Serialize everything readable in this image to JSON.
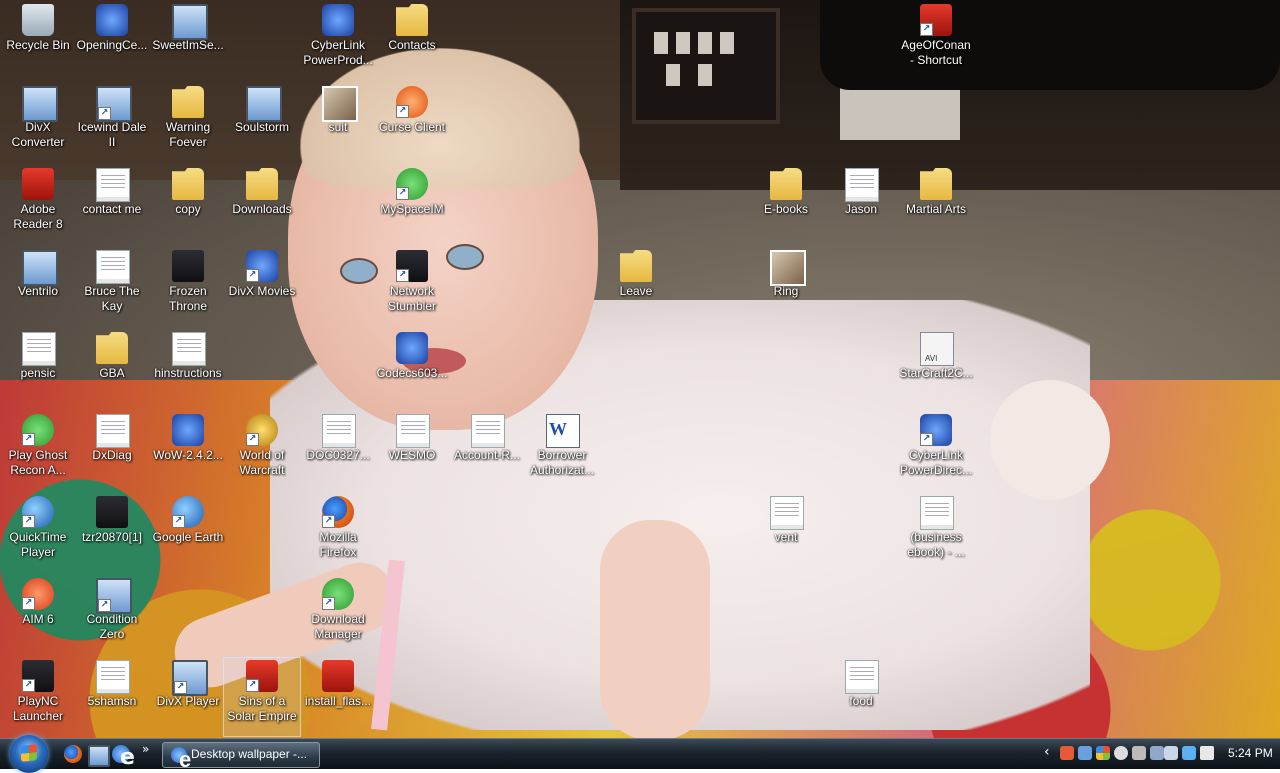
{
  "desktop": {
    "icons": [
      {
        "label": "Recycle Bin",
        "icon": "recycle-bin-icon"
      },
      {
        "label": "OpeningCe...",
        "icon": "app-icon"
      },
      {
        "label": "SweetImSe...",
        "icon": "setup-icon"
      },
      {
        "label": "CyberLink PowerProd...",
        "icon": "cyberlink-icon"
      },
      {
        "label": "Contacts",
        "icon": "folder-icon"
      },
      {
        "label": "AgeOfConan - Shortcut",
        "icon": "game-icon"
      },
      {
        "label": "DivX Converter",
        "icon": "divx-icon"
      },
      {
        "label": "Icewind Dale II",
        "icon": "game-icon"
      },
      {
        "label": "Warning Foever",
        "icon": "folder-icon"
      },
      {
        "label": "Soulstorm",
        "icon": "game-icon"
      },
      {
        "label": "suit",
        "icon": "image-icon"
      },
      {
        "label": "Curse Client",
        "icon": "curse-icon"
      },
      {
        "label": "Adobe Reader 8",
        "icon": "adobe-reader-icon"
      },
      {
        "label": "contact me",
        "icon": "document-icon"
      },
      {
        "label": "copy",
        "icon": "folder-icon"
      },
      {
        "label": "Downloads",
        "icon": "folder-icon"
      },
      {
        "label": "MySpaceIM",
        "icon": "chat-icon"
      },
      {
        "label": "E-books",
        "icon": "folder-icon"
      },
      {
        "label": "Jason",
        "icon": "document-icon"
      },
      {
        "label": "Martial Arts",
        "icon": "folder-icon"
      },
      {
        "label": "Ventrilo",
        "icon": "headset-icon"
      },
      {
        "label": "Bruce The Kay",
        "icon": "document-icon"
      },
      {
        "label": "Frozen Throne",
        "icon": "game-icon"
      },
      {
        "label": "DivX Movies",
        "icon": "divx-icon"
      },
      {
        "label": "Network Stumbler",
        "icon": "network-icon"
      },
      {
        "label": "Leave",
        "icon": "folder-icon"
      },
      {
        "label": "Ring",
        "icon": "image-icon"
      },
      {
        "label": "pensic",
        "icon": "document-icon"
      },
      {
        "label": "GBA",
        "icon": "folder-icon"
      },
      {
        "label": "hinstructions",
        "icon": "document-icon"
      },
      {
        "label": "Codecs603...",
        "icon": "codec-icon"
      },
      {
        "label": "StarCraft2C...",
        "icon": "video-file-icon"
      },
      {
        "label": "Play Ghost Recon A...",
        "icon": "game-icon"
      },
      {
        "label": "DxDiag",
        "icon": "document-icon"
      },
      {
        "label": "WoW-2.4.2...",
        "icon": "app-icon"
      },
      {
        "label": "World of Warcraft",
        "icon": "wow-icon"
      },
      {
        "label": "DOC0327...",
        "icon": "document-icon"
      },
      {
        "label": "WESMO",
        "icon": "document-icon"
      },
      {
        "label": "Account-R...",
        "icon": "document-icon"
      },
      {
        "label": "Borrower Authorizat...",
        "icon": "word-document-icon"
      },
      {
        "label": "CyberLink PowerDirec...",
        "icon": "cyberlink-icon"
      },
      {
        "label": "QuickTime Player",
        "icon": "quicktime-icon"
      },
      {
        "label": "tzr20870[1]",
        "icon": "image-icon"
      },
      {
        "label": "Google Earth",
        "icon": "globe-icon"
      },
      {
        "label": "Mozilla Firefox",
        "icon": "firefox-icon"
      },
      {
        "label": "vent",
        "icon": "document-icon"
      },
      {
        "label": "(business ebook) - ...",
        "icon": "document-icon"
      },
      {
        "label": "AIM 6",
        "icon": "aim-icon"
      },
      {
        "label": "Condition Zero",
        "icon": "game-icon"
      },
      {
        "label": "Download Manager",
        "icon": "download-icon"
      },
      {
        "label": "PlayNC Launcher",
        "icon": "app-icon"
      },
      {
        "label": "5shamsn",
        "icon": "document-icon"
      },
      {
        "label": "DivX Player",
        "icon": "divx-icon"
      },
      {
        "label": "Sins of a Solar Empire",
        "icon": "game-icon"
      },
      {
        "label": "install_flas...",
        "icon": "flash-installer-icon"
      },
      {
        "label": "food",
        "icon": "document-icon"
      }
    ]
  },
  "taskbar": {
    "start_button": "windows-start-icon",
    "quick_launch": [
      "firefox-icon",
      "show-desktop-icon",
      "internet-explorer-icon"
    ],
    "quick_launch_more": "»",
    "task_button_label": "Desktop wallpaper -...",
    "tray_chevron": "‹",
    "clock": "5:24 PM"
  }
}
